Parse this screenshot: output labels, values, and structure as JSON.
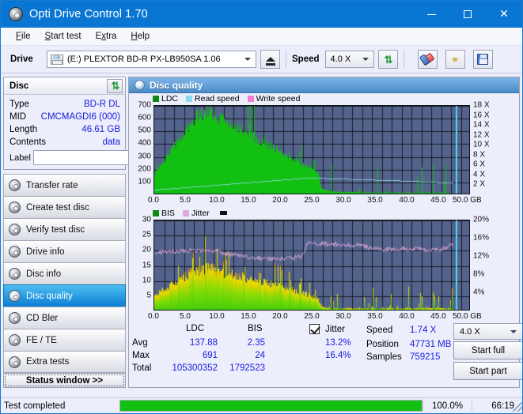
{
  "window": {
    "title": "Opti Drive Control 1.70",
    "icon": "disc-icon",
    "minimize": "–",
    "maximize": "□",
    "close": "✕"
  },
  "menu": [
    {
      "label": "File",
      "accel": "F"
    },
    {
      "label": "Start test",
      "accel": "S"
    },
    {
      "label": "Extra",
      "accel": "x"
    },
    {
      "label": "Help",
      "accel": "H"
    }
  ],
  "toolbar": {
    "drive_label": "Drive",
    "drive_value": "(E:)   PLEXTOR BD-R  PX-LB950SA 1.06",
    "eject_name": "eject-button",
    "speed_label": "Speed",
    "speed_value": "4.0 X",
    "refresh_name": "refresh-button",
    "erase_name": "erase-button",
    "bug_name": "bug-button",
    "save_name": "save-button"
  },
  "disc_panel": {
    "title": "Disc",
    "refresh_name": "disc-refresh-button",
    "rows": [
      {
        "label": "Type",
        "value": "BD-R DL"
      },
      {
        "label": "MID",
        "value": "CMCMAGDI6 (000)"
      },
      {
        "label": "Length",
        "value": "46.61 GB"
      },
      {
        "label": "Contents",
        "value": "data"
      }
    ],
    "label_field_label": "Label",
    "label_field_value": "",
    "label_field_placeholder": ""
  },
  "nav": {
    "items": [
      {
        "label": "Transfer rate",
        "active": false
      },
      {
        "label": "Create test disc",
        "active": false
      },
      {
        "label": "Verify test disc",
        "active": false
      },
      {
        "label": "Drive info",
        "active": false
      },
      {
        "label": "Disc info",
        "active": false
      },
      {
        "label": "Disc quality",
        "active": true
      },
      {
        "label": "CD Bler",
        "active": false
      },
      {
        "label": "FE / TE",
        "active": false
      },
      {
        "label": "Extra tests",
        "active": false
      }
    ],
    "status_window_button": "Status window >>"
  },
  "content": {
    "header_title": "Disc quality",
    "header_icon": "disc-quality-icon"
  },
  "stats": {
    "col_ldc": "LDC",
    "col_bis": "BIS",
    "row_avg": "Avg",
    "row_max": "Max",
    "row_total": "Total",
    "avg_ldc": "137.88",
    "avg_bis": "2.35",
    "max_ldc": "691",
    "max_bis": "24",
    "total_ldc": "105300352",
    "total_bis": "1792523",
    "jitter_label": "Jitter",
    "jitter_checked": true,
    "jitter_avg": "13.2%",
    "jitter_max": "16.4%",
    "speed_label": "Speed",
    "speed_value": "1.74 X",
    "position_label": "Position",
    "position_value": "47731 MB",
    "samples_label": "Samples",
    "samples_value": "759215",
    "speed_select": "4.0 X",
    "start_full": "Start full",
    "start_part": "Start part"
  },
  "statusbar": {
    "message": "Test completed",
    "progress_percent": "100.0%",
    "progress_value": 100,
    "elapsed": "66:19"
  },
  "colors": {
    "accent": "#0a76d4",
    "plot_bg": "#53638c",
    "grid": "#171b26",
    "ldc": "#12c012",
    "read_speed": "#96e0f5",
    "write_speed": "#f07fd0",
    "bis": "#0b8a0b",
    "jitter": "#dfa8dd",
    "value_text": "#1a1ae0",
    "progress": "#12c012"
  },
  "chart_data": [
    {
      "type": "area",
      "name": "ldc-chart",
      "title": "",
      "xlabel": "GB",
      "ylabel": "",
      "legend": [
        {
          "label": "LDC",
          "color": "#12c012"
        },
        {
          "label": "Read speed",
          "color": "#96e0f5"
        },
        {
          "label": "Write speed",
          "color": "#f07fd0"
        }
      ],
      "legend_position": "top-left",
      "grid": true,
      "xlim": [
        0.0,
        50.0
      ],
      "x_ticks": [
        "0.0",
        "5.0",
        "10.0",
        "15.0",
        "20.0",
        "25.0",
        "30.0",
        "35.0",
        "40.0",
        "45.0",
        "50.0 GB"
      ],
      "ylim": [
        0,
        700
      ],
      "y_ticks": [
        "100",
        "200",
        "300",
        "400",
        "500",
        "600",
        "700"
      ],
      "y2lim": [
        0,
        18
      ],
      "y2_ticks": [
        "2 X",
        "4 X",
        "6 X",
        "8 X",
        "10 X",
        "12 X",
        "14 X",
        "16 X",
        "18 X"
      ],
      "series": [
        {
          "name": "LDC",
          "color": "#12c012",
          "x": [
            0.0,
            0.6,
            1.2,
            1.8,
            2.4,
            3.0,
            3.6,
            4.2,
            4.8,
            5.4,
            6.0,
            6.6,
            7.2,
            7.8,
            8.4,
            9.0,
            9.6,
            10.2,
            10.8,
            11.4,
            12.0,
            12.6,
            13.2,
            13.8,
            14.4,
            15.0,
            15.6,
            16.2,
            16.8,
            17.4,
            18.0,
            18.6,
            19.2,
            19.8,
            20.4,
            21.0,
            21.6,
            22.2,
            22.8,
            23.4,
            24.0,
            24.6,
            25.2,
            25.8,
            26.4,
            27.0,
            27.6,
            28.2,
            28.8,
            29.4,
            30.0,
            30.6,
            31.2,
            31.8,
            32.4,
            33.0,
            33.6,
            34.2,
            34.8,
            35.4,
            36.0,
            36.6,
            37.2,
            37.8,
            38.4,
            39.0,
            39.6,
            40.2,
            40.8,
            41.4,
            42.0,
            42.6,
            43.2,
            43.8,
            44.4,
            45.0,
            45.6,
            46.2,
            46.8
          ],
          "values": [
            180,
            215,
            255,
            300,
            345,
            390,
            430,
            470,
            515,
            560,
            600,
            625,
            648,
            662,
            690,
            670,
            640,
            620,
            600,
            585,
            570,
            552,
            535,
            520,
            505,
            488,
            470,
            455,
            440,
            422,
            405,
            390,
            372,
            355,
            338,
            320,
            302,
            285,
            268,
            250,
            232,
            215,
            198,
            180,
            55,
            40,
            32,
            28,
            30,
            26,
            24,
            26,
            22,
            24,
            20,
            22,
            18,
            20,
            24,
            18,
            22,
            16,
            20,
            18,
            22,
            16,
            20,
            22,
            18,
            16,
            20,
            18,
            22,
            16,
            18,
            20,
            16,
            18,
            14
          ]
        },
        {
          "name": "Read speed",
          "color": "#96e0f5",
          "x": [
            0.0,
            5.0,
            10.0,
            15.0,
            20.0,
            24.0,
            24.5,
            25.0,
            30.0,
            35.0,
            40.0,
            45.0,
            46.8
          ],
          "values": [
            1.1,
            1.6,
            2.1,
            2.6,
            3.1,
            3.5,
            3.6,
            3.5,
            3.3,
            3.1,
            2.9,
            2.6,
            2.5
          ]
        }
      ]
    },
    {
      "type": "area",
      "name": "bis-chart",
      "title": "",
      "xlabel": "GB",
      "ylabel": "",
      "legend": [
        {
          "label": "BIS",
          "color": "#0b8a0b"
        },
        {
          "label": "Jitter",
          "color": "#dfa8dd"
        }
      ],
      "legend_position": "top-left",
      "grid": true,
      "xlim": [
        0.0,
        50.0
      ],
      "x_ticks": [
        "0.0",
        "5.0",
        "10.0",
        "15.0",
        "20.0",
        "25.0",
        "30.0",
        "35.0",
        "40.0",
        "45.0",
        "50.0 GB"
      ],
      "ylim": [
        0,
        30
      ],
      "y_ticks": [
        "5",
        "10",
        "15",
        "20",
        "25",
        "30"
      ],
      "y2lim": [
        0,
        20
      ],
      "y2_ticks": [
        "4%",
        "8%",
        "12%",
        "16%",
        "20%"
      ],
      "series": [
        {
          "name": "BIS",
          "color": "#0b8a0b",
          "x": [
            0.0,
            0.6,
            1.2,
            1.8,
            2.4,
            3.0,
            3.6,
            4.2,
            4.8,
            5.4,
            6.0,
            6.6,
            7.2,
            7.8,
            8.4,
            9.0,
            9.6,
            10.2,
            10.8,
            11.4,
            12.0,
            12.6,
            13.2,
            13.8,
            14.4,
            15.0,
            15.6,
            16.2,
            16.8,
            17.4,
            18.0,
            18.6,
            19.2,
            19.8,
            20.4,
            21.0,
            21.6,
            22.2,
            22.8,
            23.4,
            24.0,
            24.6,
            25.2,
            25.8,
            26.4,
            27.0,
            27.6,
            28.2,
            28.8,
            29.4,
            30.0,
            30.6,
            31.2,
            31.8,
            32.4,
            33.0,
            33.6,
            34.2,
            34.8,
            35.4,
            36.0,
            36.6,
            37.2,
            37.8,
            38.4,
            39.0,
            39.6,
            40.2,
            40.8,
            41.4,
            42.0,
            42.6,
            43.2,
            43.8,
            44.4,
            45.0,
            45.6,
            46.2,
            46.8
          ],
          "values": [
            5.4,
            6.2,
            7.1,
            8.0,
            8.8,
            9.6,
            10.4,
            11.2,
            12.0,
            12.8,
            13.4,
            13.9,
            14.3,
            14.6,
            15.0,
            14.6,
            14.1,
            13.7,
            13.3,
            13.0,
            12.7,
            12.4,
            12.1,
            11.8,
            11.5,
            11.2,
            10.8,
            10.4,
            10.1,
            9.8,
            9.5,
            9.1,
            8.8,
            8.5,
            8.1,
            7.8,
            7.4,
            7.0,
            6.6,
            6.2,
            5.8,
            5.4,
            5.0,
            4.4,
            1.6,
            1.2,
            1.0,
            0.9,
            1.1,
            0.9,
            1.0,
            1.1,
            0.9,
            1.0,
            0.8,
            1.0,
            0.9,
            1.1,
            1.0,
            0.8,
            1.1,
            0.9,
            1.2,
            1.0,
            1.1,
            0.9,
            1.0,
            1.2,
            0.9,
            1.0,
            1.1,
            0.9,
            1.2,
            1.0,
            0.9,
            1.1,
            1.0,
            0.9,
            0.8
          ]
        },
        {
          "name": "Jitter",
          "color": "#dfa8dd",
          "x": [
            0.0,
            2.0,
            4.0,
            6.0,
            8.0,
            10.0,
            12.0,
            14.0,
            16.0,
            18.0,
            20.0,
            22.0,
            23.5,
            24.0,
            24.5,
            26.0,
            28.0,
            30.0,
            32.0,
            34.0,
            36.0,
            38.0,
            40.0,
            42.0,
            44.0,
            46.0,
            46.8
          ],
          "values": [
            13.0,
            13.1,
            13.2,
            13.4,
            13.3,
            13.1,
            12.6,
            12.1,
            11.7,
            11.5,
            11.6,
            11.8,
            12.2,
            14.5,
            15.0,
            14.9,
            14.8,
            14.6,
            14.5,
            14.0,
            13.6,
            13.7,
            13.8,
            13.6,
            13.4,
            13.9,
            14.6
          ]
        }
      ]
    }
  ]
}
